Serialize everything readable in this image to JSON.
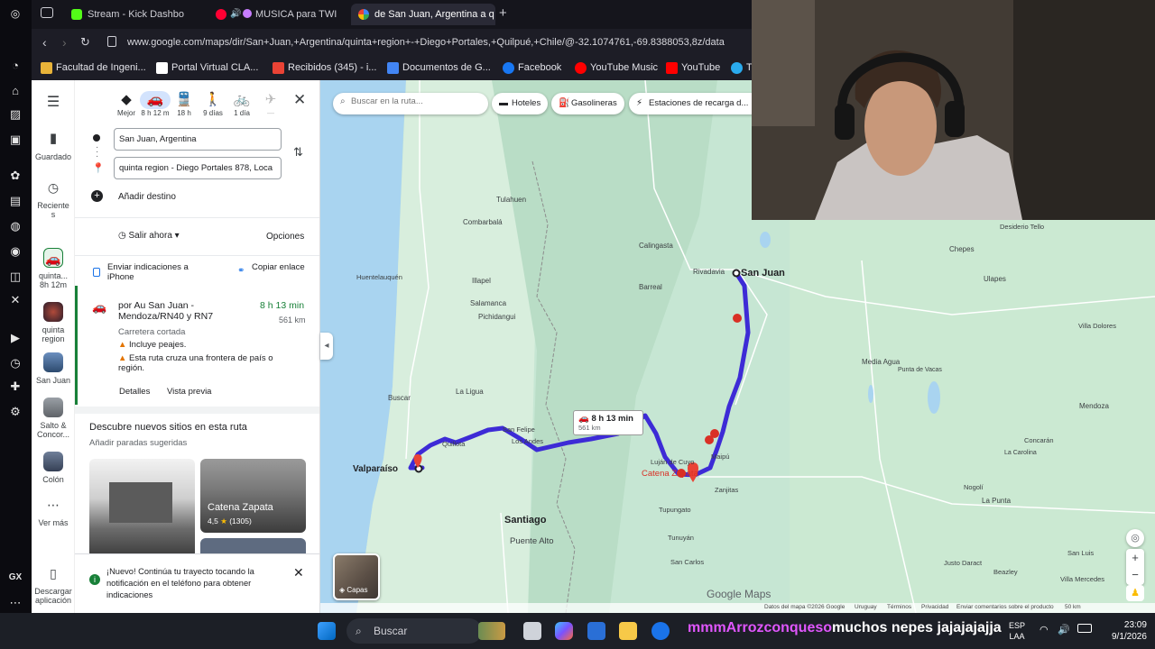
{
  "browser": {
    "tabs": [
      {
        "label": "Stream - Kick Dashbo",
        "icon": "kick-icon",
        "color": "#53fc18"
      },
      {
        "label": "MUSICA para TWI",
        "icon": "youtube-icon",
        "color": "#ff0033"
      },
      {
        "label": "de San Juan, Argentina a q",
        "icon": "google-maps-icon",
        "color": "#34a853"
      }
    ],
    "new_tab": "+",
    "url": "www.google.com/maps/dir/San+Juan,+Argentina/quinta+region+-+Diego+Portales,+Quilpué,+Chile/@-32.1074761,-69.8388053,8z/data",
    "bookmarks": [
      {
        "label": "Facultad de Ingeni...",
        "icon": "bookmark-icon",
        "color": "#e8b339"
      },
      {
        "label": "Portal Virtual CLA...",
        "icon": "page-icon",
        "color": "#ffffff"
      },
      {
        "label": "Recibidos (345) - i...",
        "icon": "gmail-icon",
        "color": "#ea4335"
      },
      {
        "label": "Documentos de G...",
        "icon": "docs-icon",
        "color": "#4285f4"
      },
      {
        "label": "Facebook",
        "icon": "facebook-icon",
        "color": "#1877f2"
      },
      {
        "label": "YouTube Music",
        "icon": "youtube-music-icon",
        "color": "#ff0000"
      },
      {
        "label": "YouTube",
        "icon": "youtube-icon",
        "color": "#ff0000"
      },
      {
        "label": "T",
        "icon": "telegram-icon",
        "color": "#2aabee"
      }
    ]
  },
  "rail": {
    "saved": "Guardado",
    "recent": "Reciente\ns",
    "items": [
      {
        "label": "quinta...\n8h 12m"
      },
      {
        "label": "quinta\nregion"
      },
      {
        "label": "San Juan"
      },
      {
        "label": "Salto &\nConcor..."
      },
      {
        "label": "Colón"
      }
    ],
    "more": "Ver más",
    "download": "Descargar\naplicación"
  },
  "directions": {
    "modes": [
      {
        "name": "Mejor",
        "icon": "diamond-icon",
        "glyph": "◆"
      },
      {
        "name": "8 h 12 m",
        "icon": "car-icon",
        "glyph": "🚗"
      },
      {
        "name": "18 h",
        "icon": "transit-icon",
        "glyph": "🚆"
      },
      {
        "name": "9 días",
        "icon": "walk-icon",
        "glyph": "🚶"
      },
      {
        "name": "1 día",
        "icon": "bike-icon",
        "glyph": "🚲"
      },
      {
        "name": "—",
        "icon": "flight-icon",
        "glyph": "✈"
      }
    ],
    "origin": "San Juan, Argentina",
    "destination": "quinta region - Diego Portales 878, Loca",
    "add_destination": "Añadir destino",
    "depart": "Salir ahora",
    "options": "Opciones",
    "send": "Enviar indicaciones a iPhone",
    "copy": "Copiar enlace",
    "route": {
      "via": "por Au San Juan - Mendoza/RN40 y RN7",
      "time": "8 h 13 min",
      "distance": "561 km",
      "note": "Carretera cortada",
      "warn1": "Incluye peajes.",
      "warn2": "Esta ruta cruza una frontera de país o región.",
      "details": "Detalles",
      "preview": "Vista previa"
    },
    "discover_title": "Descubre nuevos sitios en esta ruta",
    "discover_sub": "Añadir paradas sugeridas",
    "card_title": "Catena Zapata",
    "card_rating": "4,5",
    "card_count": "(1305)",
    "notice": "¡Nuevo! Continúa tu trayecto tocando la notificación en el teléfono para obtener indicaciones"
  },
  "map": {
    "search_placeholder": "Buscar en la ruta...",
    "chips": [
      "Hoteles",
      "Gasolineras",
      "Estaciones de recarga d..."
    ],
    "route_label_time": "8 h 13 min",
    "route_label_dist": "561 km",
    "places": [
      {
        "name": "San Juan",
        "bold": true
      },
      {
        "name": "Valparaíso",
        "bold": true
      },
      {
        "name": "Santiago",
        "bold": true
      },
      {
        "name": "Catena Zapata",
        "bold": false
      },
      {
        "name": "Puente Alto"
      },
      {
        "name": "Tulahuen"
      },
      {
        "name": "Combarbalá"
      },
      {
        "name": "Illapel"
      },
      {
        "name": "Salamanca"
      },
      {
        "name": "Pichidangui"
      },
      {
        "name": "La Ligua"
      },
      {
        "name": "Quillota"
      },
      {
        "name": "San Felipe"
      },
      {
        "name": "Los Andes"
      },
      {
        "name": "Buscar"
      },
      {
        "name": "Huentelauquén"
      },
      {
        "name": "Calingasta"
      },
      {
        "name": "Rivadavia"
      },
      {
        "name": "Barreal"
      },
      {
        "name": "Luján de Cuyo"
      },
      {
        "name": "Maipú"
      },
      {
        "name": "Tupungato"
      },
      {
        "name": "Tunuyán"
      },
      {
        "name": "San Carlos"
      },
      {
        "name": "Chepes"
      },
      {
        "name": "Desiderio Tello"
      },
      {
        "name": "Ulapes"
      },
      {
        "name": "Villa Dolores"
      },
      {
        "name": "Media Agua"
      },
      {
        "name": "Punta de Vacas"
      },
      {
        "name": "Mendoza"
      },
      {
        "name": "Concarán"
      },
      {
        "name": "La Carolina"
      },
      {
        "name": "Nogolí"
      },
      {
        "name": "La Punta"
      },
      {
        "name": "San Luis"
      },
      {
        "name": "Villa Mercedes"
      },
      {
        "name": "Justo Daract"
      },
      {
        "name": "Beazley"
      },
      {
        "name": "Zanjitas"
      },
      {
        "name": "Rivadavia "
      }
    ],
    "layers": "Capas",
    "brand": "Google Maps",
    "footer": [
      "Datos del mapa ©2026 Google",
      "Uruguay",
      "Términos",
      "Privacidad",
      "Enviar comentarios sobre el producto",
      "50 km"
    ],
    "colors": {
      "route": "#3d2bd6",
      "land": "#c6e6d3",
      "pin": "#ea4335"
    }
  },
  "taskbar": {
    "search": "Buscar",
    "chat_prefix": "mmmArrozconqueso",
    "chat_text": "muchos nepes jajajajajja",
    "lang1": "ESP",
    "lang2": "LAA",
    "time": "23:09",
    "date": "9/1/2026"
  }
}
